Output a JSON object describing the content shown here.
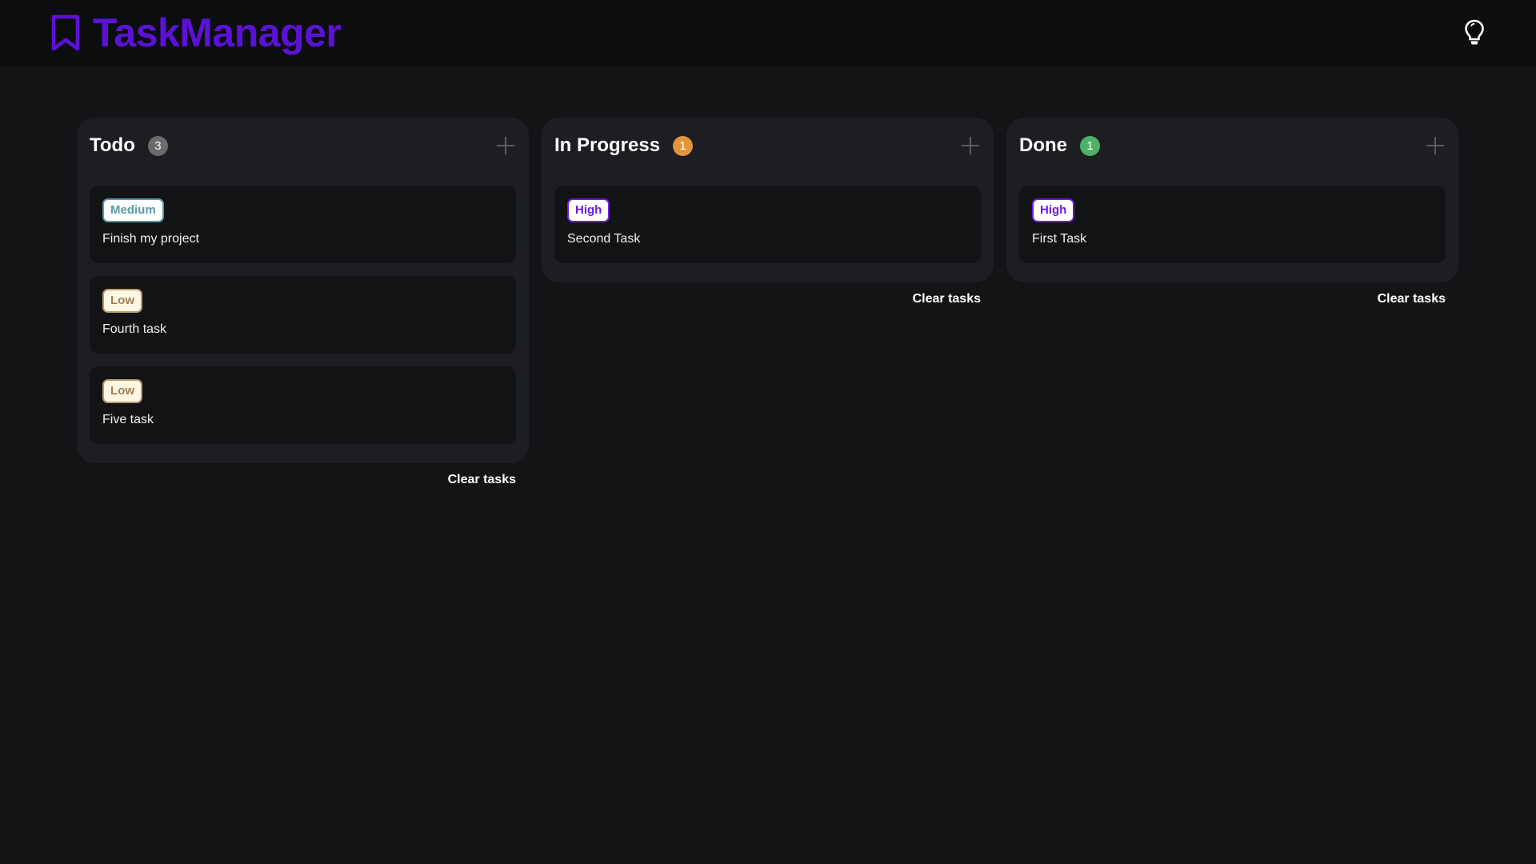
{
  "app": {
    "title": "TaskManager",
    "logo_icon": "bookmark-icon",
    "theme_toggle_icon": "lightbulb-icon",
    "brand_color": "#5b12d6"
  },
  "priorities": {
    "High": {
      "text": "#6a1be0",
      "bg": "#ffffff",
      "border": "#6a1be0"
    },
    "Medium": {
      "text": "#5b9aa3",
      "bg": "#ffffff",
      "border": "#5b9aa3"
    },
    "Low": {
      "text": "#a07e55",
      "bg": "#fff6e3",
      "border": "#b89a70"
    }
  },
  "columns": [
    {
      "title": "Todo",
      "count": "3",
      "count_color": "#6b6b6b",
      "add_icon": "plus-icon",
      "clear_label": "Clear tasks",
      "tasks": [
        {
          "priority": "Medium",
          "title": "Finish my project"
        },
        {
          "priority": "Low",
          "title": "Fourth task"
        },
        {
          "priority": "Low",
          "title": "Five task"
        }
      ]
    },
    {
      "title": "In Progress",
      "count": "1",
      "count_color": "#e3943c",
      "add_icon": "plus-icon",
      "clear_label": "Clear tasks",
      "tasks": [
        {
          "priority": "High",
          "title": "Second Task"
        }
      ]
    },
    {
      "title": "Done",
      "count": "1",
      "count_color": "#4fb167",
      "add_icon": "plus-icon",
      "clear_label": "Clear tasks",
      "tasks": [
        {
          "priority": "High",
          "title": "First Task"
        }
      ]
    }
  ]
}
